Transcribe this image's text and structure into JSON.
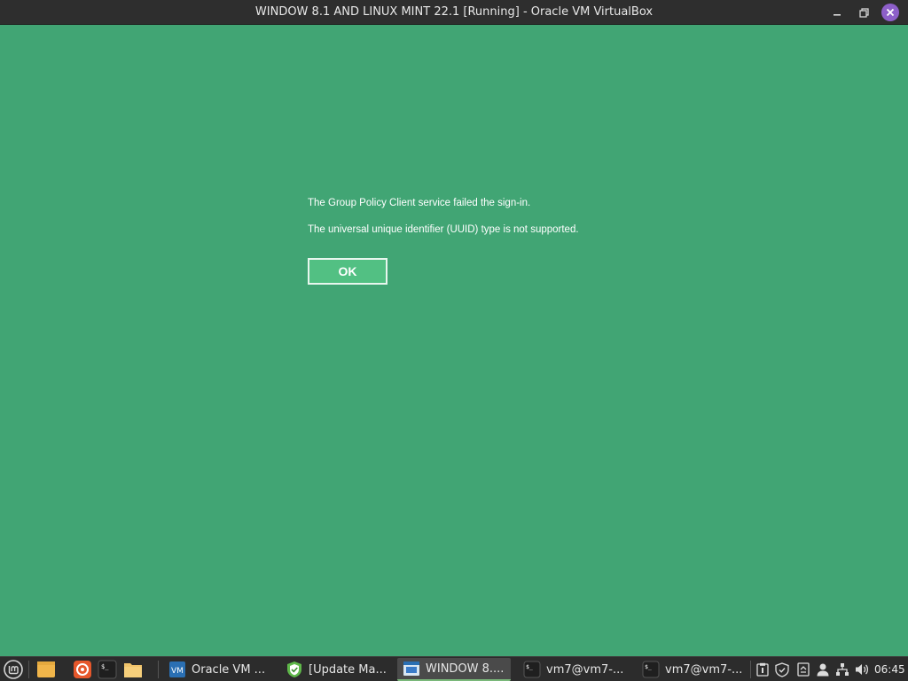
{
  "window": {
    "title": "WINDOW 8.1 AND LINUX MINT 22.1 [Running] - Oracle VM VirtualBox",
    "accent_close": "#8d5fc9"
  },
  "vm_screen": {
    "background": "#41a574",
    "message_line1": "The Group Policy Client service failed the sign-in.",
    "message_line2": "The universal unique identifier (UUID) type is not supported.",
    "ok_label": "OK"
  },
  "taskbar": {
    "launchers": [
      {
        "name": "mint-menu-icon"
      },
      {
        "name": "files-icon"
      },
      {
        "name": "firefox-icon"
      },
      {
        "name": "terminal-icon"
      },
      {
        "name": "folder-icon"
      }
    ],
    "tasks": [
      {
        "label": "Oracle VM ...",
        "icon": "virtualbox-icon",
        "active": false
      },
      {
        "label": "[Update Ma...",
        "icon": "shield-icon",
        "active": false
      },
      {
        "label": "WINDOW 8....",
        "icon": "vm-window-icon",
        "active": true
      },
      {
        "label": "vm7@vm7-...",
        "icon": "terminal-icon",
        "active": false
      },
      {
        "label": "vm7@vm7-...",
        "icon": "terminal-icon",
        "active": false
      }
    ],
    "tray": [
      "clipboard-icon",
      "shield-icon",
      "update-icon",
      "user-icon",
      "network-icon",
      "volume-icon"
    ],
    "clock": "06:45"
  }
}
